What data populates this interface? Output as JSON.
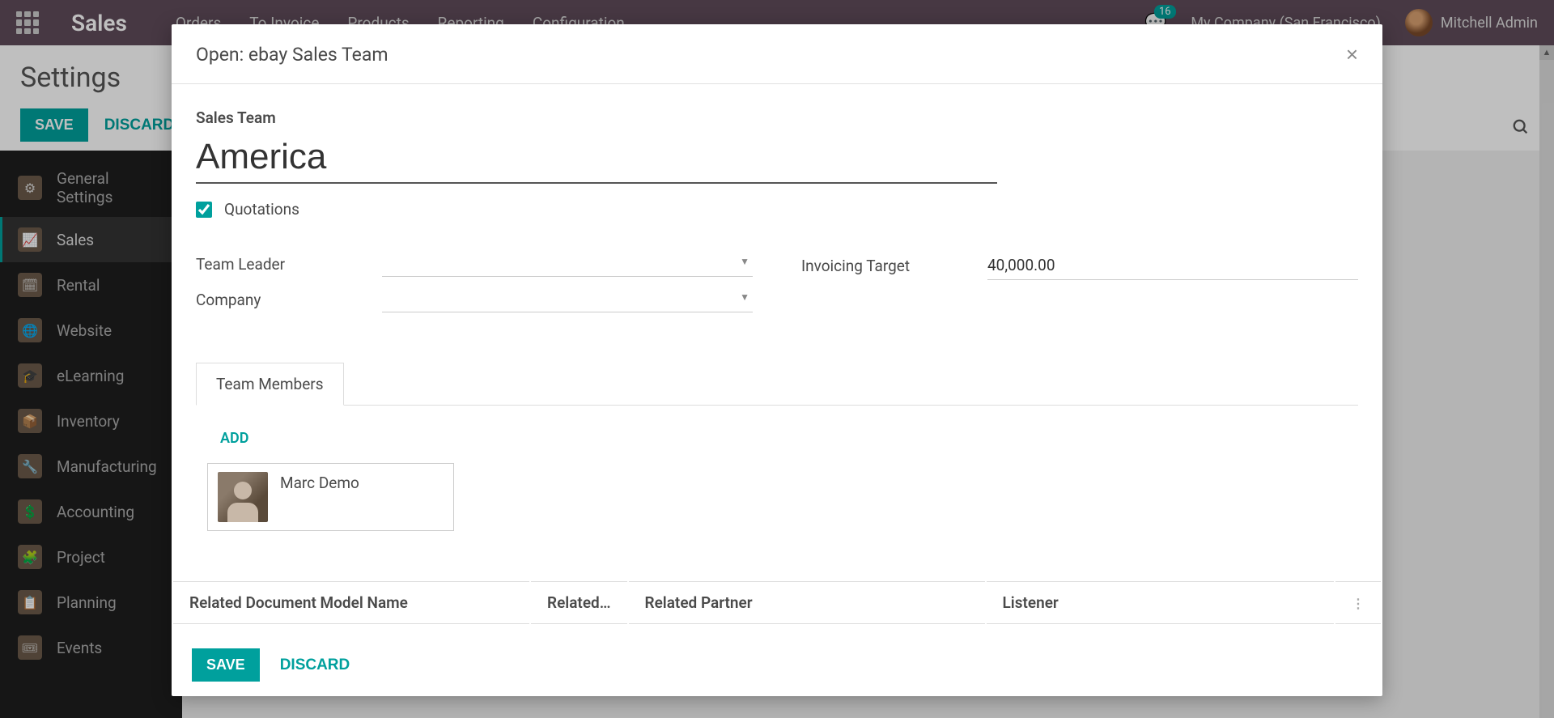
{
  "navbar": {
    "brand": "Sales",
    "menu": [
      "Orders",
      "To Invoice",
      "Products",
      "Reporting",
      "Configuration"
    ],
    "notif_count": "16",
    "company": "My Company (San Francisco)",
    "user": "Mitchell Admin"
  },
  "controlbar": {
    "title": "Settings",
    "save": "SAVE",
    "discard": "DISCARD"
  },
  "sidebar": {
    "items": [
      {
        "label": "General Settings",
        "icon": "⚙"
      },
      {
        "label": "Sales",
        "icon": "📈"
      },
      {
        "label": "Rental",
        "icon": "🗓"
      },
      {
        "label": "Website",
        "icon": "🌐"
      },
      {
        "label": "eLearning",
        "icon": "🎓"
      },
      {
        "label": "Inventory",
        "icon": "📦"
      },
      {
        "label": "Manufacturing",
        "icon": "🔧"
      },
      {
        "label": "Accounting",
        "icon": "💲"
      },
      {
        "label": "Project",
        "icon": "🧩"
      },
      {
        "label": "Planning",
        "icon": "📋"
      },
      {
        "label": "Events",
        "icon": "🎟"
      }
    ]
  },
  "modal": {
    "title": "Open: ebay Sales Team",
    "team_label": "Sales Team",
    "team_name": "America",
    "quotations_label": "Quotations",
    "quotations_checked": true,
    "team_leader_label": "Team Leader",
    "team_leader_value": "",
    "company_label": "Company",
    "company_value": "",
    "invoicing_target_label": "Invoicing Target",
    "invoicing_target_value": "40,000.00",
    "tab_members": "Team Members",
    "add": "ADD",
    "member_name": "Marc Demo",
    "table_headers": {
      "doc_model": "Related Document Model Name",
      "related": "Related…",
      "partner": "Related Partner",
      "listener": "Listener"
    },
    "save": "SAVE",
    "discard": "DISCARD"
  }
}
